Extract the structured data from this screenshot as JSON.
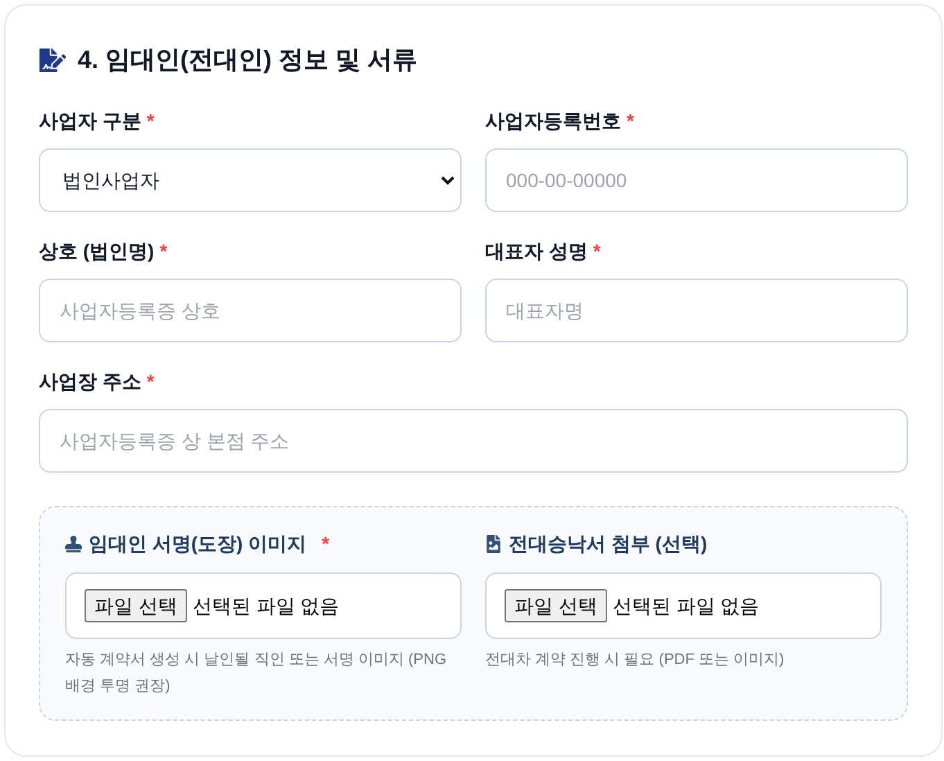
{
  "section": {
    "title": "4. 임대인(전대인) 정보 및 서류"
  },
  "rows": [
    [
      {
        "kind": "select",
        "label": "사업자 구분",
        "required_mark": "*",
        "value": "법인사업자"
      },
      {
        "kind": "text",
        "label": "사업자등록번호",
        "required_mark": "*",
        "placeholder": "000-00-00000"
      }
    ],
    [
      {
        "kind": "text",
        "label": "상호 (법인명)",
        "required_mark": "*",
        "placeholder": "사업자등록증 상호"
      },
      {
        "kind": "text",
        "label": "대표자 성명",
        "required_mark": "*",
        "placeholder": "대표자명"
      }
    ],
    [
      {
        "kind": "text",
        "label": "사업장 주소",
        "required_mark": "*",
        "placeholder": "사업자등록증 상 본점 주소"
      }
    ]
  ],
  "uploads": [
    {
      "kind": "stamp",
      "label": "임대인 서명(도장) 이미지",
      "required_mark": "*",
      "button": "파일 선택",
      "status": "선택된 파일 없음",
      "help": "자동 계약서 생성 시 날인될 직인 또는 서명 이미지 (PNG 배경 투명 권장)"
    },
    {
      "kind": "file-image",
      "label": "전대승낙서 첨부 (선택)",
      "button": "파일 선택",
      "status": "선택된 파일 없음",
      "help": "전대차 계약 진행 시 필요 (PDF 또는 이미지)"
    }
  ]
}
